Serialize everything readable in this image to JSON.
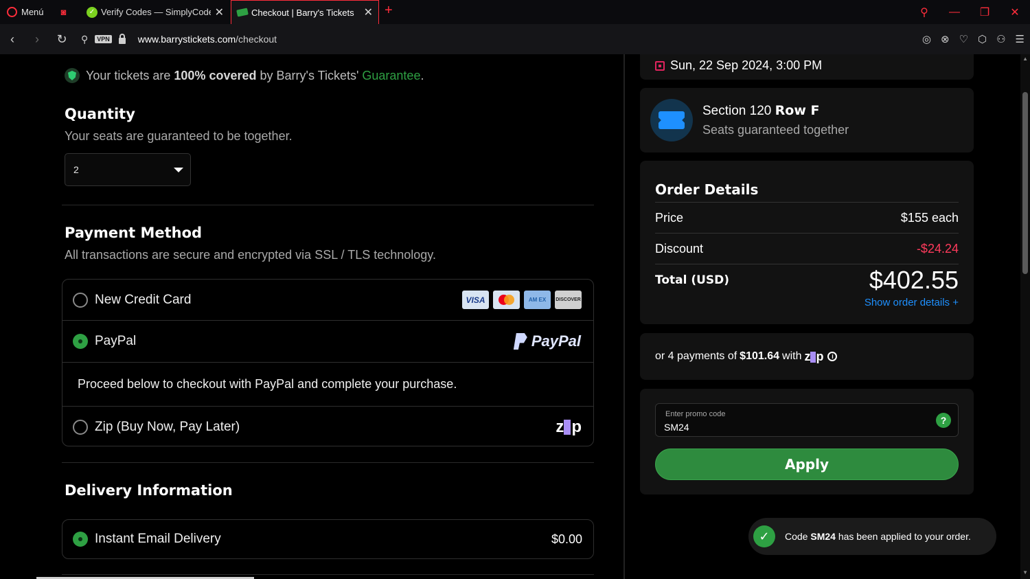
{
  "browser": {
    "menu_label": "Menú",
    "tabs": [
      {
        "title": "Verify Codes — SimplyCodes"
      },
      {
        "title": "Checkout | Barry's Tickets"
      }
    ],
    "url_domain": "www.barrystickets.com",
    "url_path": "/checkout",
    "vpn_label": "VPN"
  },
  "guarantee": {
    "prefix": "Your tickets are ",
    "bold": "100% covered",
    "middle": " by Barry's Tickets' ",
    "link": "Guarantee",
    "suffix": "."
  },
  "quantity": {
    "title": "Quantity",
    "subtitle": "Your seats are guaranteed to be together.",
    "selected": "2"
  },
  "payment": {
    "title": "Payment Method",
    "subtitle": "All transactions are secure and encrypted via SSL / TLS technology.",
    "options": [
      {
        "label": "New Credit Card",
        "checked": false
      },
      {
        "label": "PayPal",
        "checked": true
      },
      {
        "label": "Zip (Buy Now, Pay Later)",
        "checked": false
      }
    ],
    "paypal_note": "Proceed below to checkout with PayPal and complete your purchase.",
    "card_brands": [
      "VISA",
      "MC",
      "AMEX",
      "DISCOVER"
    ],
    "paypal_logo": "PayPal",
    "zip_logo": "zip"
  },
  "delivery": {
    "title": "Delivery Information",
    "option_label": "Instant Email Delivery",
    "price": "$0.00"
  },
  "event": {
    "date": "Sun, 22 Sep 2024, 3:00 PM",
    "section": "Section 120",
    "row": "Row F",
    "seats_note": "Seats guaranteed together"
  },
  "order": {
    "title": "Order Details",
    "price_label": "Price",
    "price_value": "$155 each",
    "discount_label": "Discount",
    "discount_value": "-$24.24",
    "total_label": "Total (USD)",
    "total_value": "$402.55",
    "show_details": "Show order details +"
  },
  "zip_installments": {
    "prefix": "or 4 payments of",
    "amount": "$101.64",
    "suffix": "with"
  },
  "promo": {
    "label": "Enter promo code",
    "value": "SM24",
    "apply_label": "Apply"
  },
  "toast": {
    "prefix": "Code ",
    "code": "SM24",
    "suffix": " has been applied to your order."
  },
  "colors": {
    "accent_green": "#2ea043",
    "discount_red": "#ff3b5c",
    "link_blue": "#1e90ff",
    "opera_red": "#ff2d3b"
  }
}
